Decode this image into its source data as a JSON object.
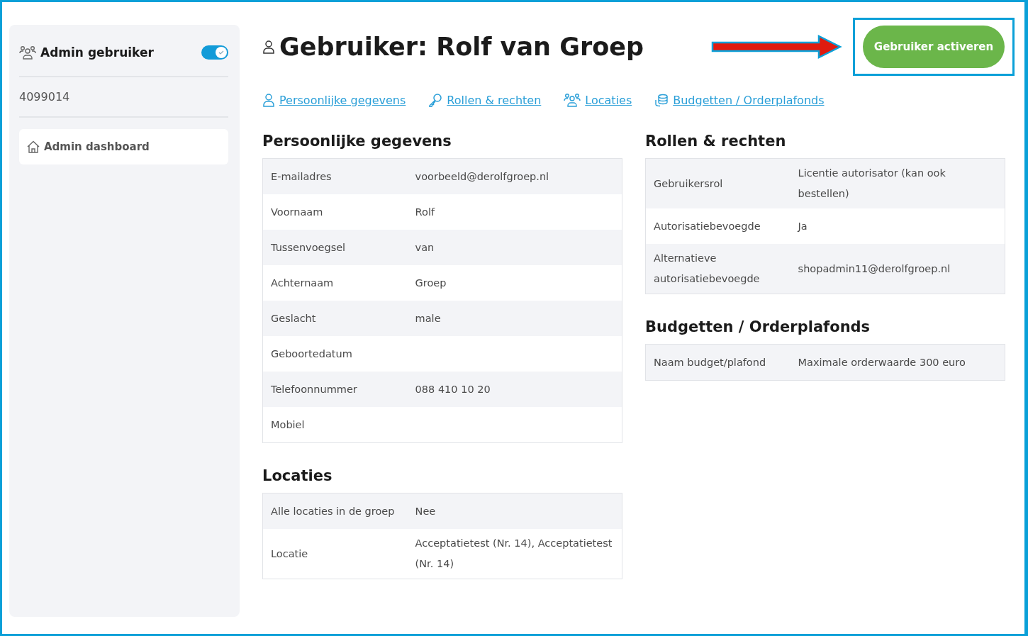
{
  "sidebar": {
    "title": "Admin gebruiker",
    "toggle_on": true,
    "user_number": "4099014",
    "items": [
      {
        "label": "Admin dashboard",
        "selected": true
      }
    ]
  },
  "header": {
    "title": "Gebruiker: Rolf van Groep",
    "action": "Gebruiker activeren",
    "action_highlighted": true
  },
  "nav_links": [
    {
      "label": "Persoonlijke gegevens",
      "kind": "person"
    },
    {
      "label": "Rollen & rechten",
      "kind": "key"
    },
    {
      "label": "Locaties",
      "kind": "group"
    },
    {
      "label": "Budgetten / Orderplafonds",
      "kind": "coins"
    }
  ],
  "columns": [
    {
      "sections": [
        {
          "title": "Persoonlijke gegevens",
          "rows": [
            {
              "label": "E-mailadres",
              "value": "voorbeeld@derolfgroep.nl"
            },
            {
              "label": "Voornaam",
              "value": "Rolf"
            },
            {
              "label": "Tussenvoegsel",
              "value": "van"
            },
            {
              "label": "Achternaam",
              "value": "Groep"
            },
            {
              "label": "Geslacht",
              "value": "male"
            },
            {
              "label": "Geboortedatum"
            },
            {
              "label": "Telefoonnummer",
              "value": "088 410 10 20"
            },
            {
              "label": "Mobiel"
            }
          ]
        },
        {
          "title": "Locaties",
          "rows": [
            {
              "label": "Alle locaties in de groep",
              "value": "Nee"
            },
            {
              "label": "Locatie",
              "value": "Acceptatietest (Nr. 14), Acceptatietest (Nr. 14)"
            }
          ]
        }
      ]
    },
    {
      "sections": [
        {
          "title": "Rollen & rechten",
          "rows": [
            {
              "label": "Gebruikersrol",
              "value": "Licentie autorisator (kan ook bestellen)"
            },
            {
              "label": "Autorisatiebevoegde",
              "value": "Ja"
            },
            {
              "label": "Alternatieve autorisatiebevoegde",
              "value": "shopadmin11@derolfgroep.nl"
            }
          ]
        },
        {
          "title": "Budgetten / Orderplafonds",
          "rows": [
            {
              "label": "Naam budget/plafond",
              "value": "Maximale orderwaarde 300 euro"
            }
          ]
        }
      ]
    }
  ]
}
